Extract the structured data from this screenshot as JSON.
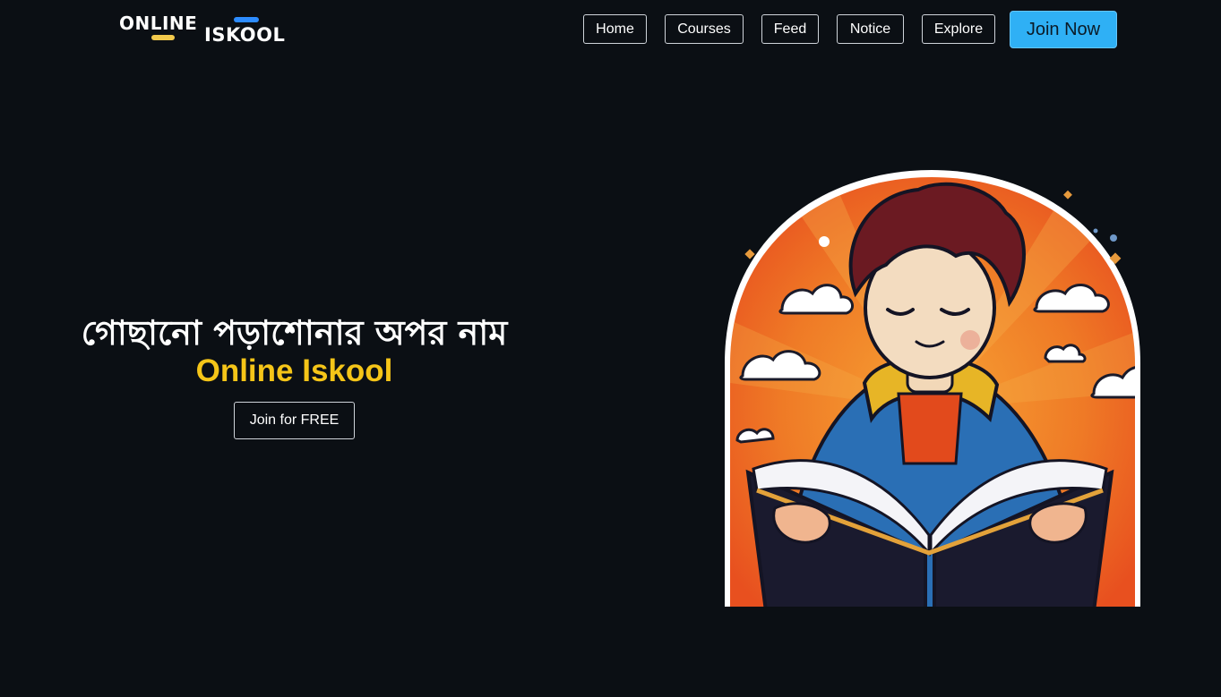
{
  "brand": {
    "word1": "ONLINE",
    "word2": "ISKOOL"
  },
  "nav": {
    "items": [
      "Home",
      "Courses",
      "Feed",
      "Notice",
      "Explore"
    ],
    "cta": "Join Now"
  },
  "hero": {
    "headline_bn": "গোছানো পড়াশোনার অপর নাম",
    "headline_en": "Online Iskool",
    "cta": "Join for FREE"
  },
  "colors": {
    "background": "#0b0f14",
    "accent_yellow": "#f5c518",
    "accent_blue": "#2fb0f5",
    "illustration_orange": "#ee5a24"
  },
  "illustration": {
    "icon": "boy-reading-book-illustration"
  }
}
